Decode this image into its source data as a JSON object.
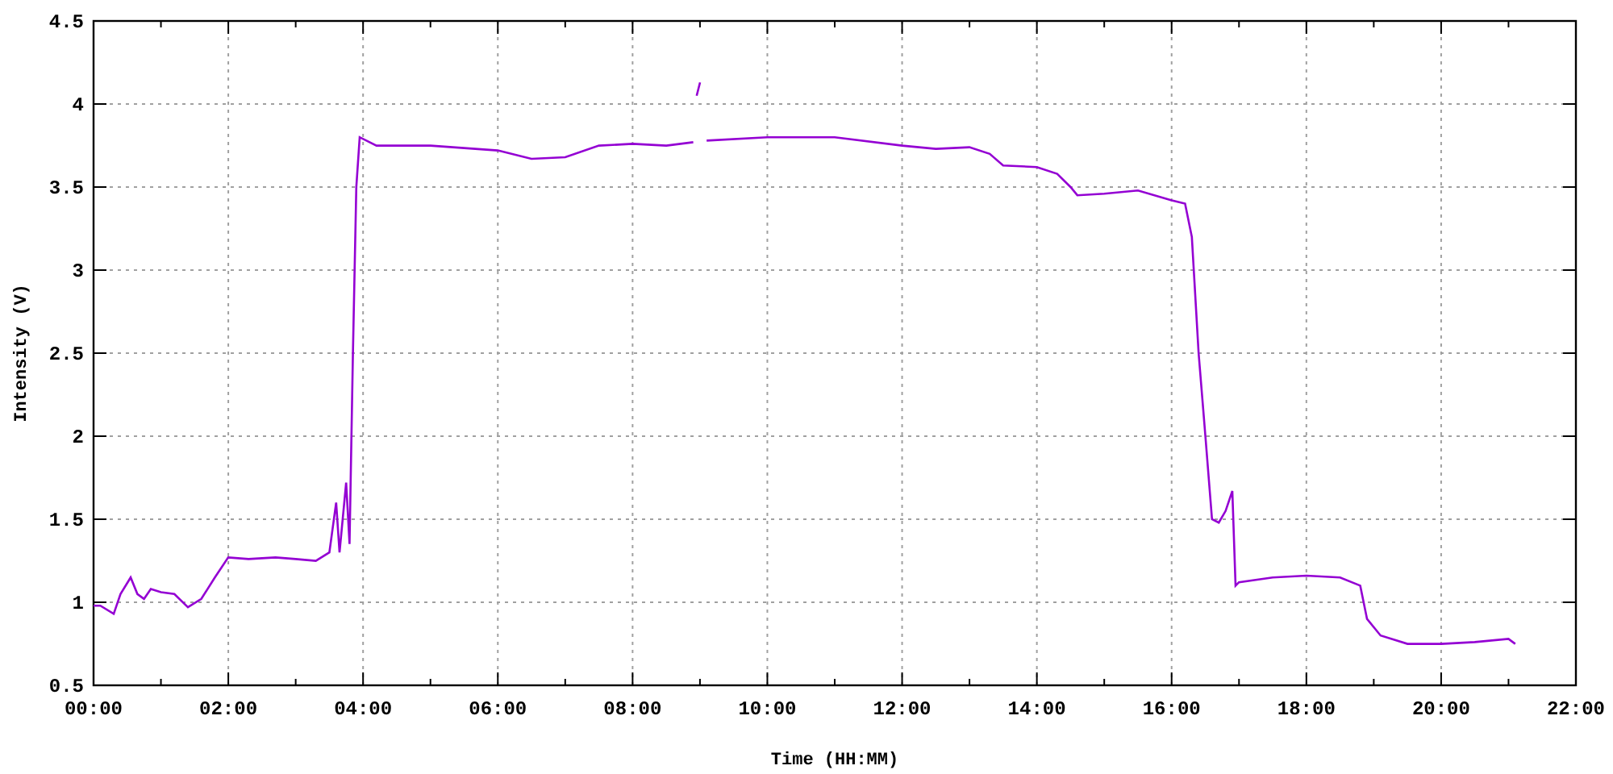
{
  "chart_data": {
    "type": "line",
    "xlabel": "Time (HH:MM)",
    "ylabel": "Intensity (V)",
    "grid": true,
    "xlim": [
      0,
      22
    ],
    "ylim": [
      0.5,
      4.5
    ],
    "xticks": [
      {
        "value": 0,
        "label": "00:00"
      },
      {
        "value": 2,
        "label": "02:00"
      },
      {
        "value": 4,
        "label": "04:00"
      },
      {
        "value": 6,
        "label": "06:00"
      },
      {
        "value": 8,
        "label": "08:00"
      },
      {
        "value": 10,
        "label": "10:00"
      },
      {
        "value": 12,
        "label": "12:00"
      },
      {
        "value": 14,
        "label": "14:00"
      },
      {
        "value": 16,
        "label": "16:00"
      },
      {
        "value": 18,
        "label": "18:00"
      },
      {
        "value": 20,
        "label": "20:00"
      },
      {
        "value": 22,
        "label": "22:00"
      }
    ],
    "yticks": [
      0.5,
      1,
      1.5,
      2,
      2.5,
      3,
      3.5,
      4,
      4.5
    ],
    "x": [
      0,
      0.1,
      0.3,
      0.4,
      0.55,
      0.65,
      0.75,
      0.85,
      1.0,
      1.2,
      1.4,
      1.6,
      1.8,
      2.0,
      2.3,
      2.7,
      3.0,
      3.3,
      3.5,
      3.6,
      3.65,
      3.75,
      3.8,
      3.85,
      3.9,
      3.95,
      4.2,
      5.0,
      6.0,
      6.5,
      7.0,
      7.5,
      8.0,
      8.5,
      8.9,
      null,
      8.95,
      9.0,
      null,
      9.1,
      10.0,
      11.0,
      12.0,
      12.5,
      13.0,
      13.3,
      13.5,
      14.0,
      14.3,
      14.5,
      14.6,
      15.0,
      15.5,
      16.0,
      16.2,
      16.3,
      16.4,
      16.5,
      16.6,
      16.7,
      16.8,
      16.9,
      16.95,
      17.0,
      17.5,
      18.0,
      18.5,
      18.8,
      18.9,
      19.1,
      19.5,
      20.0,
      20.5,
      21.0,
      21.1
    ],
    "series": [
      {
        "color": "#9400d3",
        "values": [
          0.98,
          0.98,
          0.93,
          1.05,
          1.15,
          1.05,
          1.02,
          1.08,
          1.06,
          1.05,
          0.97,
          1.02,
          1.15,
          1.27,
          1.26,
          1.27,
          1.26,
          1.25,
          1.3,
          1.6,
          1.3,
          1.72,
          1.35,
          2.5,
          3.5,
          3.8,
          3.75,
          3.75,
          3.72,
          3.67,
          3.68,
          3.75,
          3.76,
          3.75,
          3.77,
          null,
          4.05,
          4.13,
          null,
          3.78,
          3.8,
          3.8,
          3.75,
          3.73,
          3.74,
          3.7,
          3.63,
          3.62,
          3.58,
          3.5,
          3.45,
          3.46,
          3.48,
          3.42,
          3.4,
          3.2,
          2.5,
          2.0,
          1.5,
          1.48,
          1.55,
          1.67,
          1.1,
          1.12,
          1.15,
          1.16,
          1.15,
          1.1,
          0.9,
          0.8,
          0.75,
          0.75,
          0.76,
          0.78,
          0.75
        ]
      }
    ]
  }
}
